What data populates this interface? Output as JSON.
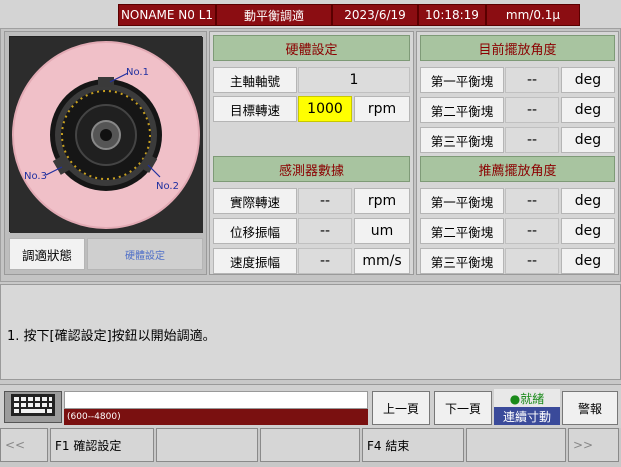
{
  "topbar": {
    "machine": "NONAME N0 L1",
    "screen_title": "動平衡調適",
    "date": "2023/6/19",
    "time": "10:18:19",
    "unit": "mm/0.1μ"
  },
  "image_panel": {
    "label_no1": "No.1",
    "label_no2": "No.2",
    "label_no3": "No.3",
    "status_label": "調適狀態",
    "status_value": "硬體設定"
  },
  "hardware": {
    "title": "硬體設定",
    "rows": [
      {
        "label": "主軸軸號",
        "value": "1",
        "unit": ""
      },
      {
        "label": "目標轉速",
        "value": "1000",
        "unit": "rpm"
      }
    ]
  },
  "sensor": {
    "title": "感測器數據",
    "rows": [
      {
        "label": "實際轉速",
        "value": "--",
        "unit": "rpm"
      },
      {
        "label": "位移振幅",
        "value": "--",
        "unit": "um"
      },
      {
        "label": "速度振幅",
        "value": "--",
        "unit": "mm/s"
      }
    ]
  },
  "current_angle": {
    "title": "目前擺放角度",
    "rows": [
      {
        "label": "第一平衡塊",
        "value": "--",
        "unit": "deg"
      },
      {
        "label": "第二平衡塊",
        "value": "--",
        "unit": "deg"
      },
      {
        "label": "第三平衡塊",
        "value": "--",
        "unit": "deg"
      }
    ]
  },
  "recommend_angle": {
    "title": "推薦擺放角度",
    "rows": [
      {
        "label": "第一平衡塊",
        "value": "--",
        "unit": "deg"
      },
      {
        "label": "第二平衡塊",
        "value": "--",
        "unit": "deg"
      },
      {
        "label": "第三平衡塊",
        "value": "--",
        "unit": "deg"
      }
    ]
  },
  "message": {
    "text": "1. 按下[確認設定]按鈕以開始調適。"
  },
  "bottom": {
    "range_hint": "(600--4800)",
    "prev_page": "上一頁",
    "next_page": "下一頁",
    "ready": "●就緒",
    "mode": "連續寸動",
    "alarm": "警報"
  },
  "fkeys": {
    "left_arrow": "<<",
    "f1": "F1 確認設定",
    "f4": "F4 結束",
    "right_arrow": ">>"
  },
  "colors": {
    "title_bar": "#8b0d12",
    "header_green": "#a8c4a0",
    "input_yellow": "#ffff00",
    "ready_green": "#1a8a1a",
    "mode_blue": "#3a4a9a",
    "wheel_pink": "#f0c0c8"
  }
}
